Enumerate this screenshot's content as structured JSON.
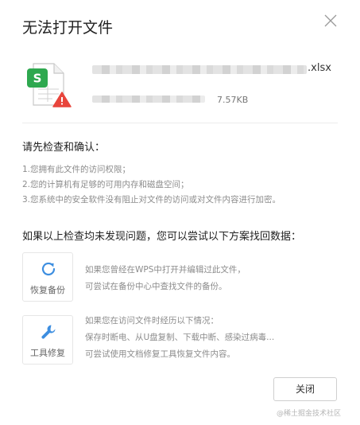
{
  "dialog": {
    "title": "无法打开文件",
    "close_icon": "close-icon"
  },
  "file": {
    "extension": ".xlsx",
    "size": "7.57KB",
    "icon": "spreadsheet-file-warning-icon",
    "badge_letter": "S",
    "colors": {
      "badge": "#2ea84f",
      "warning": "#e8453c"
    }
  },
  "check": {
    "heading": "请先检查和确认：",
    "items": [
      "1.您拥有此文件的访问权限；",
      "2.您的计算机有足够的可用内存和磁盘空间；",
      "3.您系统中的安全软件没有阻止对文件的访问或对文件内容进行加密。"
    ]
  },
  "recover": {
    "heading": "如果以上检查均未发现问题，您可以尝试以下方案找回数据：",
    "backup": {
      "label": "恢复备份",
      "icon": "refresh-icon",
      "lines": [
        "如果您曾经在WPS中打开并编辑过此文件，",
        "可尝试在备份中心中查找文件的备份。"
      ]
    },
    "repair": {
      "label": "工具修复",
      "icon": "wrench-icon",
      "lines": [
        "如果您在访问文件时经历以下情况：",
        "保存时断电、从U盘复制、下载中断、感染过病毒...",
        "可尝试使用文档修复工具恢复文件内容。"
      ]
    }
  },
  "footer": {
    "close_label": "关闭",
    "watermark": "@稀土掘金技术社区"
  },
  "colors": {
    "accent": "#3d8ee0"
  }
}
